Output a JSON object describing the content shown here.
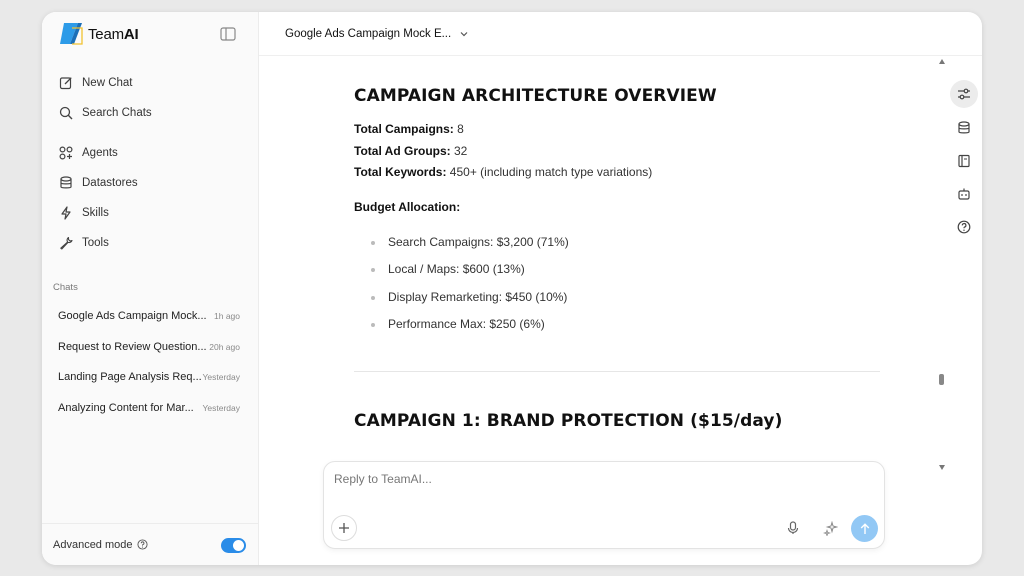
{
  "app": {
    "brand_prefix": "Team",
    "brand_suffix": "AI"
  },
  "sidebar": {
    "nav": [
      {
        "label": "New Chat",
        "icon": "edit-icon"
      },
      {
        "label": "Search Chats",
        "icon": "search-icon"
      },
      {
        "label": "Agents",
        "icon": "agents-icon"
      },
      {
        "label": "Datastores",
        "icon": "database-icon"
      },
      {
        "label": "Skills",
        "icon": "lightning-icon"
      },
      {
        "label": "Tools",
        "icon": "wrench-icon"
      }
    ],
    "chats_label": "Chats",
    "chats": [
      {
        "title": "Google Ads Campaign Mock...",
        "age": "1h ago"
      },
      {
        "title": "Request to Review Question...",
        "age": "20h ago"
      },
      {
        "title": "Landing Page Analysis Req...",
        "age": "Yesterday"
      },
      {
        "title": "Analyzing Content for Mar...",
        "age": "Yesterday"
      }
    ],
    "advanced_mode_label": "Advanced mode",
    "advanced_mode_on": true
  },
  "header": {
    "title": "Google Ads Campaign Mock E..."
  },
  "document": {
    "heading1": "CAMPAIGN ARCHITECTURE OVERVIEW",
    "stats": [
      {
        "label": "Total Campaigns:",
        "value": " 8"
      },
      {
        "label": "Total Ad Groups:",
        "value": " 32"
      },
      {
        "label": "Total Keywords:",
        "value": " 450+ (including match type variations)"
      }
    ],
    "budget_label": "Budget Allocation:",
    "budget_items": [
      "Search Campaigns: $3,200 (71%)",
      "Local / Maps: $600 (13%)",
      "Display Remarketing: $450 (10%)",
      "Performance Max: $250 (6%)"
    ],
    "heading2_bold": "CAMPAIGN 1: BRAND PROTECTION",
    "heading2_rest": " ($15/day)"
  },
  "composer": {
    "placeholder": "Reply to TeamAI..."
  },
  "colors": {
    "accent": "#2a8ce8",
    "send": "#92c8f5",
    "logo_blue": "#2d9be8",
    "logo_yellow": "#f2c230"
  },
  "rail": [
    "settings-sliders-icon",
    "database-icon",
    "notebook-icon",
    "robot-icon",
    "help-icon"
  ]
}
